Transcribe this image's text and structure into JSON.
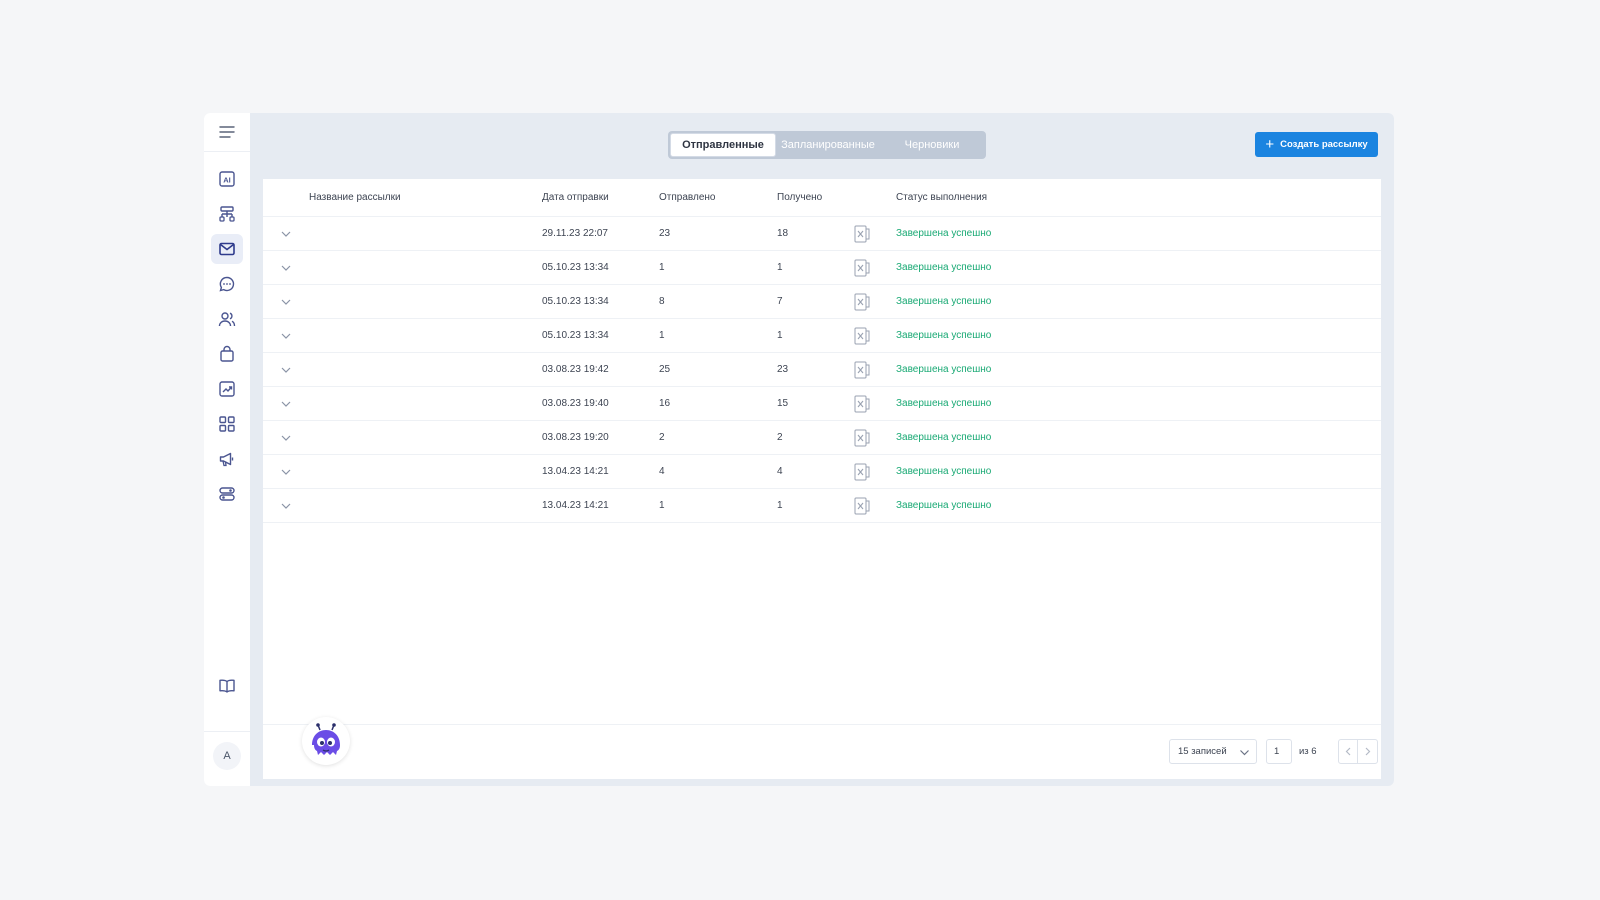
{
  "sidebar": {
    "icons": [
      "menu-icon",
      "ai-icon",
      "sitemap-icon",
      "mail-icon",
      "chat-icon",
      "users-icon",
      "bag-icon",
      "chart-icon",
      "apps-icon",
      "megaphone-icon",
      "toggles-icon",
      "book-icon"
    ],
    "avatar_letter": "A"
  },
  "tabs": [
    {
      "label": "Отправленные",
      "active": true
    },
    {
      "label": "Запланированные",
      "active": false
    },
    {
      "label": "Черновики",
      "active": false
    }
  ],
  "create_button": {
    "label": "Создать рассылку"
  },
  "table": {
    "headers": {
      "name": "Название рассылки",
      "date": "Дата отправки",
      "sent": "Отправлено",
      "received": "Получено",
      "status": "Статус выполнения"
    },
    "rows": [
      {
        "name": "",
        "date": "29.11.23 22:07",
        "sent": "23",
        "received": "18",
        "status": "Завершена успешно"
      },
      {
        "name": "",
        "date": "05.10.23 13:34",
        "sent": "1",
        "received": "1",
        "status": "Завершена успешно"
      },
      {
        "name": "",
        "date": "05.10.23 13:34",
        "sent": "8",
        "received": "7",
        "status": "Завершена успешно"
      },
      {
        "name": "",
        "date": "05.10.23 13:34",
        "sent": "1",
        "received": "1",
        "status": "Завершена успешно"
      },
      {
        "name": "",
        "date": "03.08.23 19:42",
        "sent": "25",
        "received": "23",
        "status": "Завершена успешно"
      },
      {
        "name": "",
        "date": "03.08.23 19:40",
        "sent": "16",
        "received": "15",
        "status": "Завершена успешно"
      },
      {
        "name": "",
        "date": "03.08.23 19:20",
        "sent": "2",
        "received": "2",
        "status": "Завершена успешно"
      },
      {
        "name": "",
        "date": "13.04.23 14:21",
        "sent": "4",
        "received": "4",
        "status": "Завершена успешно"
      },
      {
        "name": "",
        "date": "13.04.23 14:21",
        "sent": "1",
        "received": "1",
        "status": "Завершена успешно"
      }
    ]
  },
  "pagination": {
    "per_page": "15 записей",
    "current_page": "1",
    "of_label": "из 6"
  },
  "colors": {
    "accent": "#1b84e0",
    "status_success": "#19a974",
    "tabs_bg": "#bfc9d7",
    "app_bg": "#e6ebf2"
  }
}
